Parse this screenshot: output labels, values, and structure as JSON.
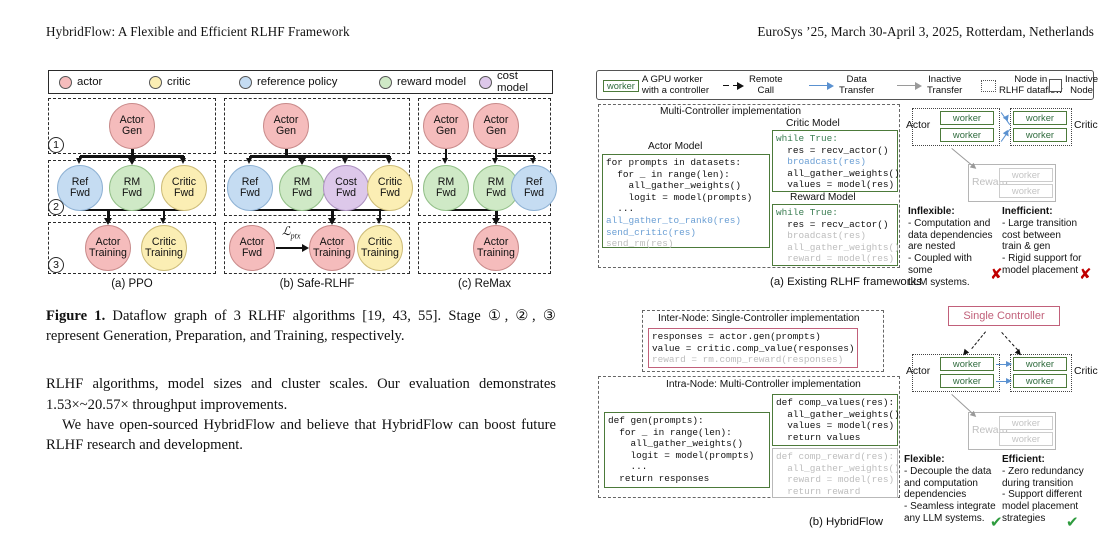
{
  "runhead": {
    "left": "HybridFlow: A Flexible and Efficient RLHF Framework",
    "right": "EuroSys ’25, March 30-April 3, 2025, Rotterdam, Netherlands"
  },
  "figure1": {
    "legend": [
      {
        "label": "actor",
        "color": "#f5bcbc"
      },
      {
        "label": "critic",
        "color": "#fbeeb4"
      },
      {
        "label": "reference policy",
        "color": "#c5dcf2"
      },
      {
        "label": "reward model",
        "color": "#cfe9c6"
      },
      {
        "label": "cost model",
        "color": "#ddc8ea"
      }
    ],
    "stages": [
      "1",
      "2",
      "3"
    ],
    "nodes": {
      "actor_gen": "Actor\nGen",
      "actor_gen_l1": "Actor",
      "actor_gen_l2": "Gen",
      "ref_fwd_l1": "Ref",
      "ref_fwd_l2": "Fwd",
      "rm_fwd_l1": "RM",
      "rm_fwd_l2": "Fwd",
      "critic_fwd_l1": "Critic",
      "critic_fwd_l2": "Fwd",
      "cost_fwd_l1": "Cost",
      "cost_fwd_l2": "Fwd",
      "actor_fwd_l1": "Actor",
      "actor_fwd_l2": "Fwd",
      "actor_train_l1": "Actor",
      "actor_train_l2": "Training",
      "critic_train_l1": "Critic",
      "critic_train_l2": "Training"
    },
    "ptx_loss": "ptx",
    "subcaptions": {
      "a": "(a) PPO",
      "b": "(b) Safe-RLHF",
      "c": "(c) ReMax"
    },
    "caption_bold": "Figure 1.",
    "caption": " Dataflow graph of 3 RLHF algorithms [19, 43, 55]. Stage ①, ②, ③ represent Generation, Preparation, and Training, respectively."
  },
  "body": {
    "p1": "RLHF algorithms, model sizes and cluster scales. Our evaluation demonstrates 1.53×~20.57× throughput improvements.",
    "p2": "We have open-sourced HybridFlow and believe that HybridFlow can boost future RLHF research and development."
  },
  "figure2": {
    "legend": [
      {
        "chip": "worker",
        "line1": "A GPU worker",
        "line2": "with a controller",
        "icon": "worker-chip"
      },
      {
        "icon": "dashed-arrow-icon",
        "line1": "Remote",
        "line2": "Call"
      },
      {
        "icon": "blue-arrow-icon",
        "line1": "Data",
        "line2": "Transfer"
      },
      {
        "icon": "grey-arrow-icon",
        "line1": "Inactive",
        "line2": "Transfer"
      },
      {
        "icon": "dotted-box-icon",
        "line1": "Node in",
        "line2": "RLHF dataflow"
      },
      {
        "icon": "plain-box-icon",
        "line1": "Inactive",
        "line2": "Node"
      }
    ],
    "panel_a": {
      "title": "Multi-Controller implementation",
      "actor_model_title": "Actor Model",
      "critic_model_title": "Critic Model",
      "reward_model_title": "Reward Model",
      "actor_code": [
        {
          "t": "for prompts in datasets:",
          "s": "normal"
        },
        {
          "t": "  for _ in range(len):",
          "s": "normal"
        },
        {
          "t": "    all_gather_weights()",
          "s": "normal"
        },
        {
          "t": "    logit = model(prompts)",
          "s": "normal"
        },
        {
          "t": "  ...",
          "s": "normal"
        },
        {
          "t": "all_gather_to_rank0(res)",
          "s": "fn"
        },
        {
          "t": "send_critic(res)",
          "s": "fn"
        },
        {
          "t": "send_rm(res)",
          "s": "dim"
        }
      ],
      "critic_code": [
        {
          "t": "while True:",
          "s": "kw"
        },
        {
          "t": "  res = recv_actor()",
          "s": "mixed"
        },
        {
          "t": "  broadcast(res)",
          "s": "fn"
        },
        {
          "t": "  all_gather_weights()",
          "s": "normal"
        },
        {
          "t": "  values = model(res)",
          "s": "normal"
        }
      ],
      "reward_code": [
        {
          "t": "while True:",
          "s": "kw"
        },
        {
          "t": "  res = recv_actor()",
          "s": "mixed"
        },
        {
          "t": "  broadcast(res)",
          "s": "dim"
        },
        {
          "t": "  all_gather_weights()",
          "s": "dim"
        },
        {
          "t": "  reward = model(res)",
          "s": "dim"
        }
      ],
      "graph": {
        "actor_label": "Actor",
        "critic_label": "Critic",
        "reward_label": "Reward",
        "worker_label": "worker"
      },
      "blurb_left_title": "Inflexible:",
      "blurb_left": "- Computation and\ndata dependencies\nare nested\n- Coupled with some\nLLM systems.",
      "blurb_right_title": "Inefficient:",
      "blurb_right": "- Large transition\ncost between\ntrain & gen\n- Rigid support for\nmodel placement",
      "mark_left": "✘",
      "mark_right": "✘",
      "caption": "(a) Existing RLHF frameworks"
    },
    "panel_b": {
      "inter_title": "Inter-Node: Single-Controller implementation",
      "intra_title": "Intra-Node: Multi-Controller implementation",
      "inter_code": [
        {
          "t": "responses = actor.gen(prompts)",
          "s": "mixed"
        },
        {
          "t": "value = critic.comp_value(responses)",
          "s": "mixed"
        },
        {
          "t": "reward = rm.comp_reward(responses)",
          "s": "dim"
        }
      ],
      "gen_code": [
        {
          "t": "def gen(prompts):",
          "s": "normal"
        },
        {
          "t": "  for _ in range(len):",
          "s": "normal"
        },
        {
          "t": "    all_gather_weights()",
          "s": "normal"
        },
        {
          "t": "    logit = model(prompts)",
          "s": "normal"
        },
        {
          "t": "    ...",
          "s": "normal"
        },
        {
          "t": "  return responses",
          "s": "normal"
        }
      ],
      "comp_values_code": [
        {
          "t": "def comp_values(res):",
          "s": "normal"
        },
        {
          "t": "  all_gather_weights()",
          "s": "normal"
        },
        {
          "t": "  values = model(res)",
          "s": "normal"
        },
        {
          "t": "  return values",
          "s": "normal"
        }
      ],
      "comp_reward_code": [
        {
          "t": "def comp_reward(res):",
          "s": "dim"
        },
        {
          "t": "  all_gather_weights()",
          "s": "dim"
        },
        {
          "t": "  reward = model(res)",
          "s": "dim"
        },
        {
          "t": "  return reward",
          "s": "dim"
        }
      ],
      "single_controller": "Single Controller",
      "graph": {
        "actor_label": "Actor",
        "critic_label": "Critic",
        "reward_label": "Reward",
        "worker_label": "worker"
      },
      "blurb_left_title": "Flexible:",
      "blurb_left": "- Decouple the data\n and computation\ndependencies\n- Seamless integrate\nany LLM systems.",
      "blurb_right_title": "Efficient:",
      "blurb_right": "-  Zero redundancy\nduring transition\n- Support different\nmodel placement\nstrategies",
      "mark_left": "✔",
      "mark_right": "✔",
      "caption": "(b) HybridFlow"
    }
  },
  "colors": {
    "actor": "#f5bcbc",
    "critic": "#fbeeb4",
    "reference_policy": "#c5dcf2",
    "reward_model": "#cfe9c6",
    "cost_model": "#ddc8ea",
    "worker_green": "#4c7a3a",
    "single_controller_red": "#c1607a",
    "data_transfer_blue": "#5a91d0",
    "inactive_grey": "#b5b5b5",
    "check_green": "#2e9b3e",
    "cross_red": "#c00000"
  }
}
